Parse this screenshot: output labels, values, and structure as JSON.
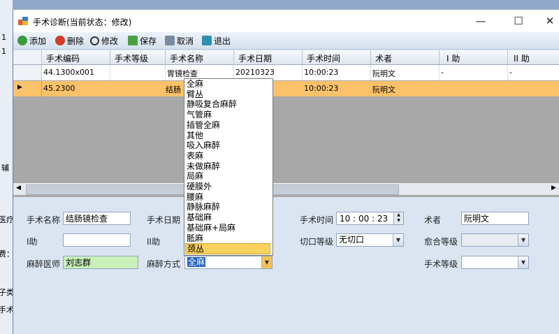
{
  "background_app": {
    "left_fragments": [
      "1",
      "1",
      "辅",
      "医疗",
      "费：",
      "子类",
      "手术"
    ]
  },
  "window": {
    "title": "手术诊断(当前状态：修改)",
    "controls": {
      "minimize": "—",
      "maximize": "☐",
      "close": "✕"
    }
  },
  "toolbar": {
    "add": "添加",
    "delete": "删除",
    "edit": "修改",
    "save": "保存",
    "cancel": "取消",
    "exit": "退出"
  },
  "grid": {
    "columns": [
      "手术编码",
      "手术等级",
      "手术名称",
      "手术日期",
      "手术时间",
      "术者",
      "I 助",
      "II 助"
    ],
    "rows": [
      {
        "code": "44.1300x001",
        "level": "",
        "name": "胃镜检查",
        "date": "20210323",
        "time": "10:00:23",
        "surgeon": "阮明文",
        "assist1": "-",
        "assist2": "-"
      },
      {
        "code": "45.2300",
        "level": "",
        "name": "结肠",
        "date": "",
        "time": "10:00:23",
        "surgeon": "阮明文",
        "assist1": "",
        "assist2": ""
      }
    ],
    "current_row_marker": "▶"
  },
  "form": {
    "surgery_name_label": "手术名称",
    "surgery_name_value": "结肠镜检查",
    "surgery_date_label": "手术日期",
    "surgery_time_label": "手术时间",
    "surgery_time_value": "10 : 00 : 23",
    "surgeon_label": "术者",
    "surgeon_value": "阮明文",
    "assist1_label": "I助",
    "assist1_value": "",
    "assist2_label": "II助",
    "incision_level_label": "切口等级",
    "incision_level_value": "无切口",
    "healing_level_label": "愈合等级",
    "healing_level_value": "",
    "anesthesiologist_label": "麻醉医师",
    "anesthesiologist_value": "刘志群",
    "anesthesia_method_label": "麻醉方式",
    "anesthesia_method_value": "全麻",
    "surgery_level_label": "手术等级",
    "surgery_level_value": ""
  },
  "anesthesia_options": [
    "全麻",
    "臂丛",
    "静吸复合麻醉",
    "气管麻",
    "插管全麻",
    "其他",
    "吸入麻醉",
    "表麻",
    "未做麻醉",
    "局麻",
    "硬膜外",
    "腰麻",
    "静脉麻醉",
    "基础麻",
    "基础麻+局麻",
    "骶麻",
    "颈丛"
  ],
  "anesthesia_highlighted": "颈丛",
  "colors": {
    "selected_row": "#fbc26a",
    "anesthesiologist_field": "#c8f0b8",
    "highlight_option": "#f9d15c"
  }
}
